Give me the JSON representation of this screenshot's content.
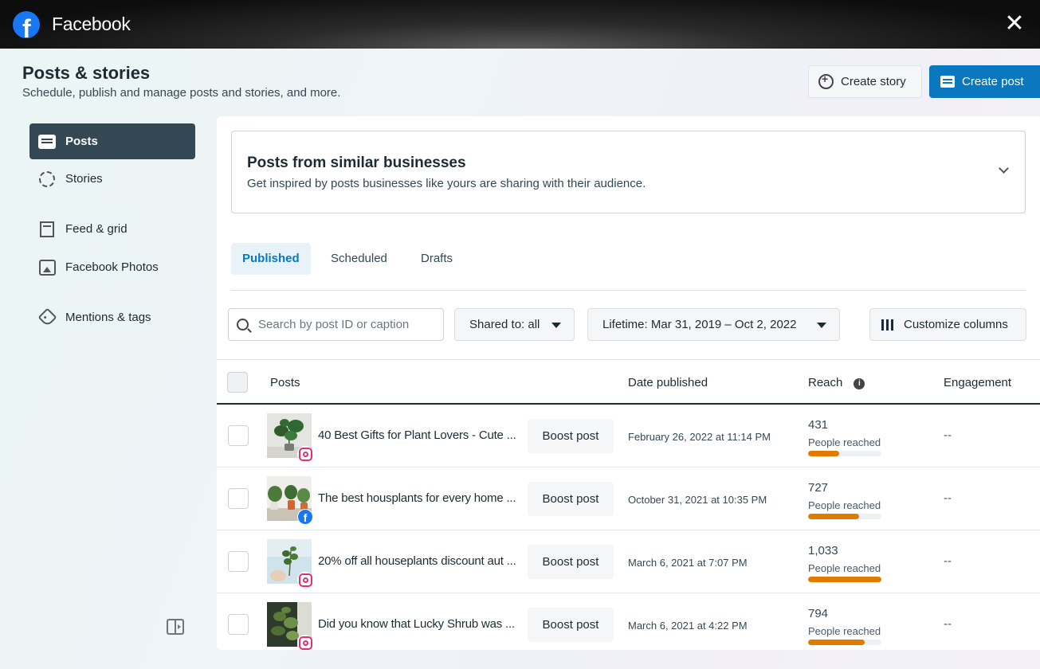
{
  "window": {
    "title": "Facebook"
  },
  "header": {
    "title": "Posts & stories",
    "subtitle": "Schedule, publish and manage posts and stories, and more.",
    "create_story": "Create story",
    "create_post": "Create post"
  },
  "sidebar": {
    "items": [
      {
        "label": "Posts",
        "icon": "posts-icon",
        "active": true
      },
      {
        "label": "Stories",
        "icon": "stories-icon"
      },
      {
        "label": "Feed & grid",
        "icon": "feed-grid-icon"
      },
      {
        "label": "Facebook Photos",
        "icon": "photos-icon"
      },
      {
        "label": "Mentions & tags",
        "icon": "tag-icon"
      }
    ]
  },
  "suggestion": {
    "title": "Posts from similar businesses",
    "subtitle": "Get inspired by posts businesses like yours are sharing with their audience."
  },
  "tabs": [
    "Published",
    "Scheduled",
    "Drafts"
  ],
  "filters": {
    "search_placeholder": "Search by post ID or caption",
    "shared_to": "Shared to: all",
    "date_range": "Lifetime: Mar 31, 2019 – Oct 2, 2022",
    "customize": "Customize columns"
  },
  "table": {
    "columns": [
      "Posts",
      "Date published",
      "Reach",
      "Engagement"
    ],
    "rows": [
      {
        "caption": "40 Best Gifts for Plant Lovers - Cute ...",
        "platform": "instagram",
        "boost": "Boost post",
        "date": "February 26, 2022 at 11:14 PM",
        "reach": "431",
        "reach_label": "People reached",
        "reach_fraction": 0.42,
        "engagement": "--"
      },
      {
        "caption": "The best housplants for every home ...",
        "platform": "facebook",
        "boost": "Boost post",
        "date": "October 31, 2021 at 10:35 PM",
        "reach": "727",
        "reach_label": "People reached",
        "reach_fraction": 0.7,
        "engagement": "--"
      },
      {
        "caption": "20% off all houseplants discount aut ...",
        "platform": "instagram",
        "boost": "Boost post",
        "date": "March 6, 2021 at 7:07 PM",
        "reach": "1,033",
        "reach_label": "People reached",
        "reach_fraction": 1.0,
        "engagement": "--"
      },
      {
        "caption": "Did you know that Lucky Shrub was ...",
        "platform": "instagram",
        "boost": "Boost post",
        "date": "March 6, 2021 at 4:22 PM",
        "reach": "794",
        "reach_label": "People reached",
        "reach_fraction": 0.77,
        "engagement": "--"
      }
    ]
  },
  "colors": {
    "primary": "#0a78be",
    "nav_active": "#344854",
    "reach_bar": "#e07b00",
    "facebook": "#1877f2",
    "instagram": "#e1306c"
  }
}
